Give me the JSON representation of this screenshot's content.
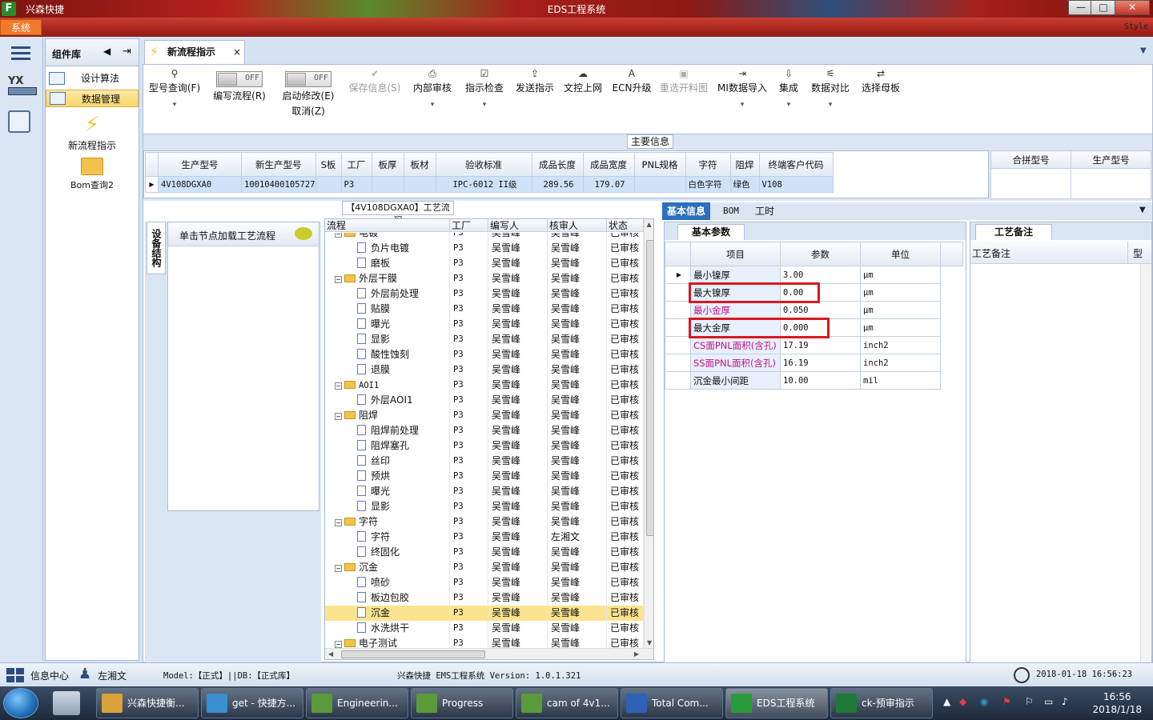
{
  "window": {
    "app_name": "兴森快捷",
    "title": "EDS工程系统",
    "minimize": "—",
    "maximize": "□",
    "close": "✕"
  },
  "ribbon": {
    "system_tab": "系统",
    "style_label": "Style"
  },
  "component_panel": {
    "title": "组件库",
    "items": [
      {
        "label": "设计算法"
      },
      {
        "label": "数据管理"
      }
    ],
    "big_items": [
      {
        "label": "新流程指示"
      },
      {
        "label": "Bom查询2"
      }
    ]
  },
  "doc_tab": {
    "label": "新流程指示",
    "close": "×"
  },
  "toolbar": {
    "buttons": [
      {
        "label": "型号查询(F)",
        "icon": "search-icon",
        "glyph": "⚲",
        "dropdown": true
      },
      {
        "label": "编写流程(R)",
        "toggle": "OFF"
      },
      {
        "label": "启动修改(E)",
        "sub": "取消(Z)",
        "toggle": "OFF"
      },
      {
        "label": "保存信息(S)",
        "icon": "check-icon",
        "glyph": "✔",
        "disabled": true
      },
      {
        "label": "内部审核",
        "icon": "print-icon",
        "glyph": "⎙",
        "dropdown": true
      },
      {
        "label": "指示检查",
        "icon": "checkbox-icon",
        "glyph": "☑",
        "dropdown": true
      },
      {
        "label": "发送指示",
        "icon": "upload-icon",
        "glyph": "⇪"
      },
      {
        "label": "文控上网",
        "icon": "cloud-upload-icon",
        "glyph": "☁"
      },
      {
        "label": "ECN升级",
        "icon": "font-icon",
        "glyph": "A"
      },
      {
        "label": "重选开料图",
        "icon": "image-icon",
        "glyph": "▣",
        "disabled": true
      },
      {
        "label": "MI数据导入",
        "icon": "import-icon",
        "glyph": "⇥",
        "dropdown": true
      },
      {
        "label": "集成",
        "icon": "download-icon",
        "glyph": "⇩",
        "dropdown": true
      },
      {
        "label": "数据对比",
        "icon": "compare-icon",
        "glyph": "⚟",
        "dropdown": true
      },
      {
        "label": "选择母板",
        "icon": "shuffle-icon",
        "glyph": "⇄"
      }
    ]
  },
  "main_info": {
    "label": "主要信息",
    "columns": [
      "生产型号",
      "新生产型号",
      "S板",
      "工厂",
      "板厚",
      "板材",
      "验收标准",
      "成品长度",
      "成品宽度",
      "PNL规格",
      "字符",
      "阻焊",
      "终端客户代码"
    ],
    "row": [
      "4V108DGXA0",
      "10010400105727",
      "",
      "P3",
      "",
      "",
      "IPC-6012 II级",
      "289.56",
      "179.07",
      "",
      "白色字符",
      "绿色",
      "V108"
    ],
    "merge_columns": [
      "合拼型号",
      "生产型号"
    ]
  },
  "bottom_tabs": [
    "基本信息",
    "BOM",
    "工时"
  ],
  "side_tab": {
    "label": "设备结构",
    "load_text": "单击节点加载工艺流程"
  },
  "flow": {
    "title": "【4V108DGXA0】工艺流程",
    "columns": [
      "流程",
      "工厂",
      "编写人",
      "核审人",
      "状态"
    ],
    "rows": [
      {
        "name": "电镀",
        "level": 0,
        "factory": "P3",
        "writer": "吴雪峰",
        "reviewer": "吴雪峰",
        "status": "已审核"
      },
      {
        "name": "负片电镀",
        "level": 1,
        "factory": "P3",
        "writer": "吴雪峰",
        "reviewer": "吴雪峰",
        "status": "已审核"
      },
      {
        "name": "磨板",
        "level": 1,
        "factory": "P3",
        "writer": "吴雪峰",
        "reviewer": "吴雪峰",
        "status": "已审核"
      },
      {
        "name": "外层干膜",
        "level": 0,
        "factory": "P3",
        "writer": "吴雪峰",
        "reviewer": "吴雪峰",
        "status": "已审核"
      },
      {
        "name": "外层前处理",
        "level": 1,
        "factory": "P3",
        "writer": "吴雪峰",
        "reviewer": "吴雪峰",
        "status": "已审核"
      },
      {
        "name": "贴膜",
        "level": 1,
        "factory": "P3",
        "writer": "吴雪峰",
        "reviewer": "吴雪峰",
        "status": "已审核"
      },
      {
        "name": "曝光",
        "level": 1,
        "factory": "P3",
        "writer": "吴雪峰",
        "reviewer": "吴雪峰",
        "status": "已审核"
      },
      {
        "name": "显影",
        "level": 1,
        "factory": "P3",
        "writer": "吴雪峰",
        "reviewer": "吴雪峰",
        "status": "已审核"
      },
      {
        "name": "酸性蚀刻",
        "level": 1,
        "factory": "P3",
        "writer": "吴雪峰",
        "reviewer": "吴雪峰",
        "status": "已审核"
      },
      {
        "name": "退膜",
        "level": 1,
        "factory": "P3",
        "writer": "吴雪峰",
        "reviewer": "吴雪峰",
        "status": "已审核"
      },
      {
        "name": "AOI1",
        "level": 0,
        "factory": "P3",
        "writer": "吴雪峰",
        "reviewer": "吴雪峰",
        "status": "已审核"
      },
      {
        "name": "外层AOI1",
        "level": 1,
        "factory": "P3",
        "writer": "吴雪峰",
        "reviewer": "吴雪峰",
        "status": "已审核"
      },
      {
        "name": "阻焊",
        "level": 0,
        "factory": "P3",
        "writer": "吴雪峰",
        "reviewer": "吴雪峰",
        "status": "已审核"
      },
      {
        "name": "阻焊前处理",
        "level": 1,
        "factory": "P3",
        "writer": "吴雪峰",
        "reviewer": "吴雪峰",
        "status": "已审核"
      },
      {
        "name": "阻焊塞孔",
        "level": 1,
        "factory": "P3",
        "writer": "吴雪峰",
        "reviewer": "吴雪峰",
        "status": "已审核"
      },
      {
        "name": "丝印",
        "level": 1,
        "factory": "P3",
        "writer": "吴雪峰",
        "reviewer": "吴雪峰",
        "status": "已审核"
      },
      {
        "name": "预烘",
        "level": 1,
        "factory": "P3",
        "writer": "吴雪峰",
        "reviewer": "吴雪峰",
        "status": "已审核"
      },
      {
        "name": "曝光",
        "level": 1,
        "factory": "P3",
        "writer": "吴雪峰",
        "reviewer": "吴雪峰",
        "status": "已审核"
      },
      {
        "name": "显影",
        "level": 1,
        "factory": "P3",
        "writer": "吴雪峰",
        "reviewer": "吴雪峰",
        "status": "已审核"
      },
      {
        "name": "字符",
        "level": 0,
        "factory": "P3",
        "writer": "吴雪峰",
        "reviewer": "吴雪峰",
        "status": "已审核"
      },
      {
        "name": "字符",
        "level": 1,
        "factory": "P3",
        "writer": "吴雪峰",
        "reviewer": "左湘文",
        "status": "已审核"
      },
      {
        "name": "终固化",
        "level": 1,
        "factory": "P3",
        "writer": "吴雪峰",
        "reviewer": "吴雪峰",
        "status": "已审核"
      },
      {
        "name": "沉金",
        "level": 0,
        "factory": "P3",
        "writer": "吴雪峰",
        "reviewer": "吴雪峰",
        "status": "已审核"
      },
      {
        "name": "喷砂",
        "level": 1,
        "factory": "P3",
        "writer": "吴雪峰",
        "reviewer": "吴雪峰",
        "status": "已审核"
      },
      {
        "name": "板边包胶",
        "level": 1,
        "factory": "P3",
        "writer": "吴雪峰",
        "reviewer": "吴雪峰",
        "status": "已审核"
      },
      {
        "name": "沉金",
        "level": 1,
        "factory": "P3",
        "writer": "吴雪峰",
        "reviewer": "吴雪峰",
        "status": "已审核",
        "selected": true
      },
      {
        "name": "水洗烘干",
        "level": 1,
        "factory": "P3",
        "writer": "吴雪峰",
        "reviewer": "吴雪峰",
        "status": "已审核"
      },
      {
        "name": "电子测试",
        "level": 0,
        "factory": "P3",
        "writer": "吴雪峰",
        "reviewer": "吴雪峰",
        "status": "已审核"
      }
    ]
  },
  "basic_params": {
    "tab": "基本参数",
    "columns": [
      "项目",
      "参数",
      "单位"
    ],
    "rows": [
      {
        "item": "最小镍厚",
        "value": "3.00",
        "unit": "μm"
      },
      {
        "item": "最大镍厚",
        "value": "0.00",
        "unit": "μm",
        "highlight": true
      },
      {
        "item": "最小金厚",
        "value": "0.050",
        "unit": "μm",
        "pink": true
      },
      {
        "item": "最大金厚",
        "value": "0.000",
        "unit": "μm",
        "highlight": true
      },
      {
        "item": "CS面PNL面积(含孔)",
        "value": "17.19",
        "unit": "inch2",
        "pink": true
      },
      {
        "item": "SS面PNL面积(含孔)",
        "value": "16.19",
        "unit": "inch2",
        "pink": true
      },
      {
        "item": "沉金最小间距",
        "value": "10.00",
        "unit": "mil"
      }
    ]
  },
  "process_note": {
    "tab": "工艺备注",
    "columns": [
      "工艺备注",
      "型"
    ]
  },
  "statusbar": {
    "info_center": "信息中心",
    "user": "左湘文",
    "model_db": "Model:【正式】||DB:【正式库】",
    "version": "兴森快捷 EMS工程系统 Version: 1.0.1.321",
    "datetime": "2018-01-18 16:56:23"
  },
  "taskbar": {
    "tasks": [
      {
        "label": "兴森快捷衡...",
        "color": "#d9a23a"
      },
      {
        "label": "get - 快捷方...",
        "color": "#3a8fd0"
      },
      {
        "label": "Engineerin...",
        "color": "#5a9a3a"
      },
      {
        "label": "Progress",
        "color": "#5a9a3a"
      },
      {
        "label": "cam of 4v1...",
        "color": "#5a9a3a"
      },
      {
        "label": "Total Com...",
        "color": "#2e62b5"
      },
      {
        "label": "EDS工程系统",
        "color": "#2b9a3b"
      },
      {
        "label": "ck-预审指示",
        "color": "#1f7a3a"
      }
    ],
    "time": "16:56",
    "date": "2018/1/18"
  }
}
